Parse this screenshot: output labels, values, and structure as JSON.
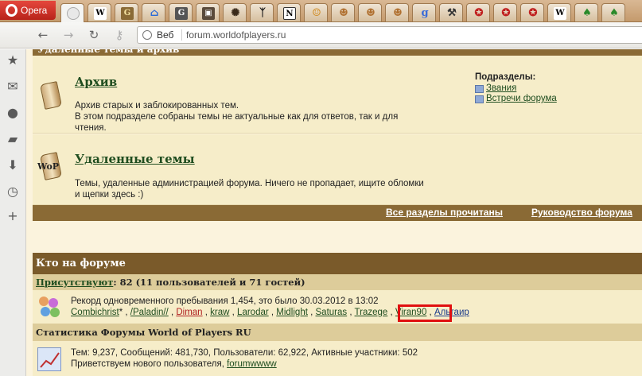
{
  "browser": {
    "opera_label": "Opera",
    "address_web_label": "Веб",
    "url": "forum.worldofplayers.ru"
  },
  "forum": {
    "category_header": "Удаленные темы и архив",
    "forums": [
      {
        "title": "Архив",
        "desc_line1": "Архив старых и заблокированных тем.",
        "desc_line2": "В этом подразделе собраны темы не актуальные как для ответов, так и для",
        "desc_line3": "чтения."
      },
      {
        "title": "Удаленные темы",
        "desc_line1": "Темы, удаленные администрацией форума. Ничего не пропадает, ищите обломки",
        "desc_line2": "и щепки здесь :)"
      }
    ],
    "subforums_label": "Подразделы:",
    "subforums": [
      "Звания",
      "Встречи форума"
    ],
    "wop_badge": "WoP",
    "footer_links": [
      "Все разделы прочитаны",
      "Руководство форума"
    ]
  },
  "online": {
    "header": "Кто на форуме",
    "present_label": "Присутствуют",
    "present_value": ": 82 (11 пользователей и 71 гостей)",
    "record_text": "Рекорд одновременного пребывания 1,454, это было 30.03.2012 в 13:02",
    "users": [
      {
        "name": "Combichrist",
        "suffix": "*",
        "style": "green"
      },
      {
        "name": "/Paladin//",
        "suffix": "",
        "style": "green"
      },
      {
        "name": "Diman",
        "suffix": "",
        "style": "red"
      },
      {
        "name": "kraw",
        "suffix": "",
        "style": "green"
      },
      {
        "name": "Larodar",
        "suffix": "",
        "style": "green"
      },
      {
        "name": "Midlight",
        "suffix": "",
        "style": "green"
      },
      {
        "name": "Saturas",
        "suffix": "",
        "style": "green"
      },
      {
        "name": "Trazege",
        "suffix": "",
        "style": "green"
      },
      {
        "name": "Viran90",
        "suffix": "",
        "style": "green"
      },
      {
        "name": "Альтаир",
        "suffix": "",
        "style": "blue"
      }
    ]
  },
  "stats": {
    "header": "Статистика Форумы World of Players RU",
    "line1": "Тем: 9,237, Сообщений: 481,730, Пользователи: 62,922, Активные участники: 502",
    "line2_prefix": "Приветствуем нового пользователя, ",
    "new_user": "forumwwww"
  },
  "colors": {
    "highlight": "#e01010",
    "link_green": "#1f4d1f",
    "header_brown": "#7a5a2a"
  }
}
